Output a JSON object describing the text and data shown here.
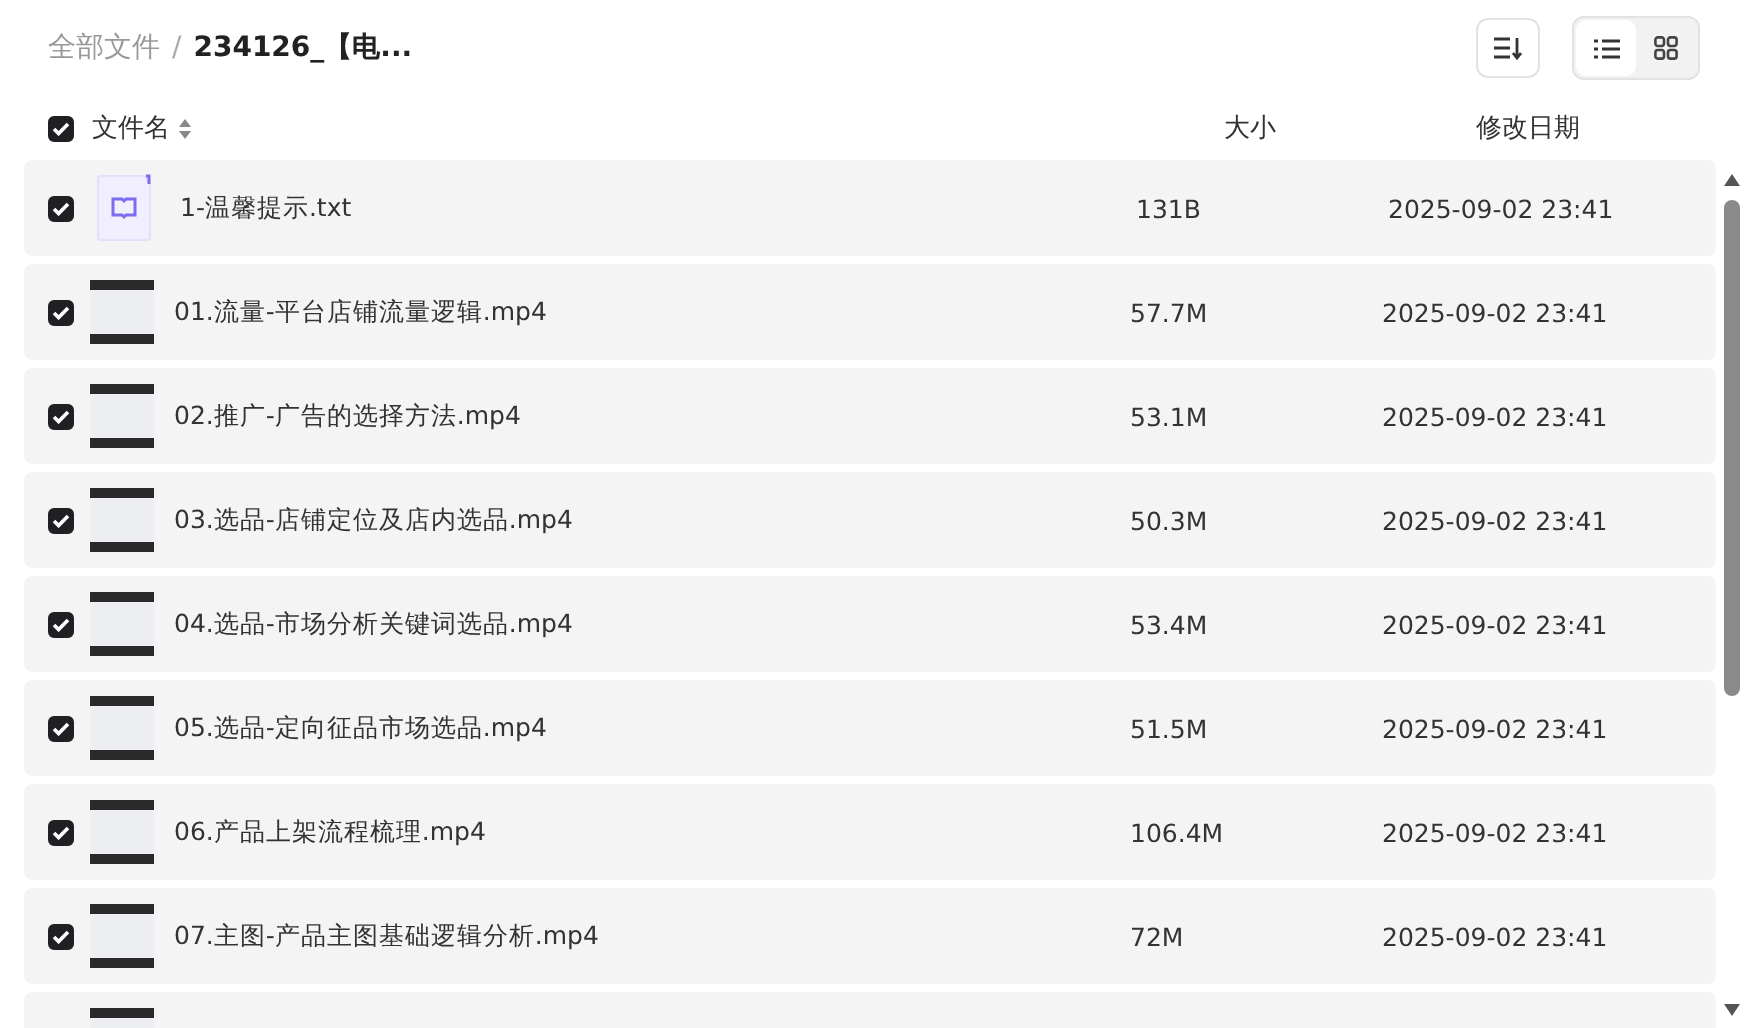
{
  "breadcrumb": [
    {
      "label": "全部文件",
      "current": false
    },
    {
      "label": "234126_【电...",
      "current": true
    }
  ],
  "breadcrumb_separator": "/",
  "view_modes": [
    {
      "kind": "list",
      "selected": true
    },
    {
      "kind": "grid",
      "selected": false
    }
  ],
  "columns": {
    "select_all": {
      "checked": true
    },
    "name": "文件名",
    "size": "大小",
    "modified": "修改日期"
  },
  "files": [
    {
      "kind": "text",
      "checked": true,
      "name": "1-温馨提示.txt",
      "size": "131B",
      "modified": "2025-09-02 23:41"
    },
    {
      "kind": "video",
      "checked": true,
      "name": "01.流量-平台店铺流量逻辑.mp4",
      "size": "57.7M",
      "modified": "2025-09-02 23:41"
    },
    {
      "kind": "video",
      "checked": true,
      "name": "02.推广-广告的选择方法.mp4",
      "size": "53.1M",
      "modified": "2025-09-02 23:41"
    },
    {
      "kind": "video",
      "checked": true,
      "name": "03.选品-店铺定位及店内选品.mp4",
      "size": "50.3M",
      "modified": "2025-09-02 23:41"
    },
    {
      "kind": "video",
      "checked": true,
      "name": "04.选品-市场分析关键词选品.mp4",
      "size": "53.4M",
      "modified": "2025-09-02 23:41"
    },
    {
      "kind": "video",
      "checked": true,
      "name": "05.选品-定向征品市场选品.mp4",
      "size": "51.5M",
      "modified": "2025-09-02 23:41"
    },
    {
      "kind": "video",
      "checked": true,
      "name": "06.产品上架流程梳理.mp4",
      "size": "106.4M",
      "modified": "2025-09-02 23:41"
    },
    {
      "kind": "video",
      "checked": true,
      "name": "07.主图-产品主图基础逻辑分析.mp4",
      "size": "72M",
      "modified": "2025-09-02 23:41"
    },
    {
      "kind": "video"
    }
  ]
}
